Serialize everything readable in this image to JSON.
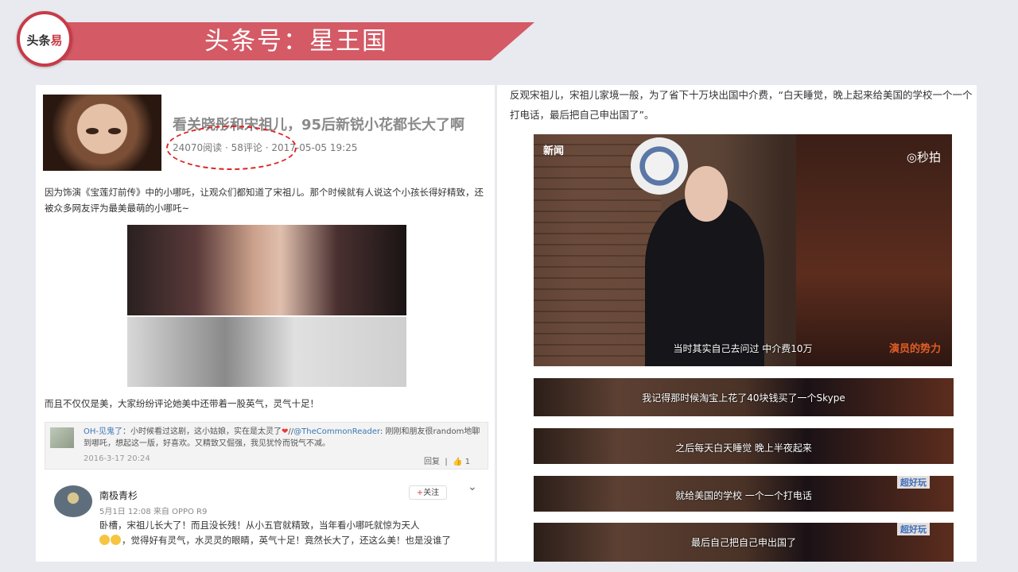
{
  "header": {
    "logo_a": "头条",
    "logo_b": "易",
    "title": "头条号：星王国"
  },
  "left": {
    "article_title": "看关晓彤和宋祖儿，95后新锐小花都长大了啊",
    "article_meta": "24070阅读 · 58评论 · 2017-05-05 19:25",
    "para1": "因为饰演《宝莲灯前传》中的小哪吒，让观众们都知道了宋祖儿。那个时候就有人说这个小孩长得好精致，还被众多网友评为最美最萌的小哪吒~",
    "para2": "而且不仅仅是美，大家纷纷评论她美中还带着一股英气，灵气十足！",
    "comment1": {
      "user": "OH-见鬼了",
      "text_a": "：小时候看过这剧，这小姑娘，实在是太灵了",
      "heart": "❤",
      "text_b": "//",
      "mention": "@TheCommonReader",
      "text_c": ": 刚刚和朋友很random地聊到哪吒，想起这一版，好喜欢。又精致又倔强，我见犹怜而锐气不减。",
      "time": "2016-3-17 20:24",
      "reply": "回复",
      "like_icon": "👍",
      "likes": "1"
    },
    "comment2": {
      "name": "南极青杉",
      "info": "5月1日 12:08 来自 OPPO R9",
      "follow_plus": "+",
      "follow": "关注",
      "chevron": "⌄",
      "text_a": "卧槽，宋祖儿长大了！而且没长残！从小五官就精致，当年看小哪吒就惊为天人",
      "text_b": "，觉得好有灵气，水灵灵的眼睛，英气十足！竟然长大了，还这么美！也是没谁了"
    }
  },
  "right": {
    "text": "反观宋祖儿，宋祖儿家境一般，为了省下十万块出国中介费，“白天睡觉，晚上起来给美国的学校一个一个打电话，最后把自己申出国了”。",
    "video": {
      "logo_left": "新闻",
      "logo_right": "◎秒拍",
      "watermark": "演员的势力",
      "subtitle": "当时其实自己去问过 中介费10万"
    },
    "strips": [
      {
        "subtitle": "我记得那时候淘宝上花了40块钱买了一个Skype",
        "mark": ""
      },
      {
        "subtitle": "之后每天白天睡觉 晚上半夜起来",
        "mark": ""
      },
      {
        "subtitle": "就给美国的学校 一个一个打电话",
        "mark": "超好玩"
      },
      {
        "subtitle": "最后自己把自己申出国了",
        "mark": "超好玩"
      }
    ]
  }
}
